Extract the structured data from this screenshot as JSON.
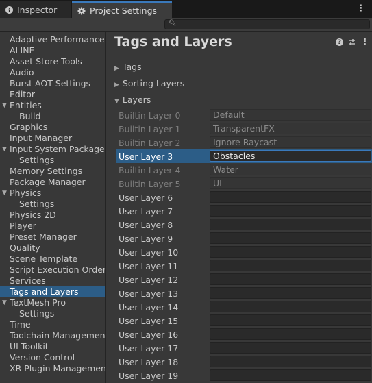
{
  "tabs": {
    "inspector": "Inspector",
    "project_settings": "Project Settings"
  },
  "search": {
    "value": ""
  },
  "sidebar": {
    "selected": "Tags and Layers",
    "items": [
      {
        "label": "Adaptive Performance",
        "level": 0
      },
      {
        "label": "ALINE",
        "level": 0
      },
      {
        "label": "Asset Store Tools",
        "level": 0
      },
      {
        "label": "Audio",
        "level": 0
      },
      {
        "label": "Burst AOT Settings",
        "level": 0
      },
      {
        "label": "Editor",
        "level": 0
      },
      {
        "label": "Entities",
        "level": 0,
        "expanded": true
      },
      {
        "label": "Build",
        "level": 1
      },
      {
        "label": "Graphics",
        "level": 0
      },
      {
        "label": "Input Manager",
        "level": 0
      },
      {
        "label": "Input System Package",
        "level": 0,
        "expanded": true
      },
      {
        "label": "Settings",
        "level": 1
      },
      {
        "label": "Memory Settings",
        "level": 0
      },
      {
        "label": "Package Manager",
        "level": 0
      },
      {
        "label": "Physics",
        "level": 0,
        "expanded": true
      },
      {
        "label": "Settings",
        "level": 1
      },
      {
        "label": "Physics 2D",
        "level": 0
      },
      {
        "label": "Player",
        "level": 0
      },
      {
        "label": "Preset Manager",
        "level": 0
      },
      {
        "label": "Quality",
        "level": 0
      },
      {
        "label": "Scene Template",
        "level": 0
      },
      {
        "label": "Script Execution Order",
        "level": 0
      },
      {
        "label": "Services",
        "level": 0
      },
      {
        "label": "Tags and Layers",
        "level": 0
      },
      {
        "label": "TextMesh Pro",
        "level": 0,
        "expanded": true
      },
      {
        "label": "Settings",
        "level": 1
      },
      {
        "label": "Time",
        "level": 0
      },
      {
        "label": "Toolchain Management",
        "level": 0
      },
      {
        "label": "UI Toolkit",
        "level": 0
      },
      {
        "label": "Version Control",
        "level": 0
      },
      {
        "label": "XR Plugin Management",
        "level": 0
      }
    ]
  },
  "main": {
    "title": "Tags and Layers",
    "sections": {
      "tags": "Tags",
      "sorting_layers": "Sorting Layers",
      "layers": "Layers"
    },
    "layers": [
      {
        "label": "Builtin Layer 0",
        "value": "Default",
        "builtin": true
      },
      {
        "label": "Builtin Layer 1",
        "value": "TransparentFX",
        "builtin": true
      },
      {
        "label": "Builtin Layer 2",
        "value": "Ignore Raycast",
        "builtin": true
      },
      {
        "label": "User Layer 3",
        "value": "Obstacles",
        "builtin": false,
        "selected": true
      },
      {
        "label": "Builtin Layer 4",
        "value": "Water",
        "builtin": true
      },
      {
        "label": "Builtin Layer 5",
        "value": "UI",
        "builtin": true
      },
      {
        "label": "User Layer 6",
        "value": "",
        "builtin": false
      },
      {
        "label": "User Layer 7",
        "value": "",
        "builtin": false
      },
      {
        "label": "User Layer 8",
        "value": "",
        "builtin": false
      },
      {
        "label": "User Layer 9",
        "value": "",
        "builtin": false
      },
      {
        "label": "User Layer 10",
        "value": "",
        "builtin": false
      },
      {
        "label": "User Layer 11",
        "value": "",
        "builtin": false
      },
      {
        "label": "User Layer 12",
        "value": "",
        "builtin": false
      },
      {
        "label": "User Layer 13",
        "value": "",
        "builtin": false
      },
      {
        "label": "User Layer 14",
        "value": "",
        "builtin": false
      },
      {
        "label": "User Layer 15",
        "value": "",
        "builtin": false
      },
      {
        "label": "User Layer 16",
        "value": "",
        "builtin": false
      },
      {
        "label": "User Layer 17",
        "value": "",
        "builtin": false
      },
      {
        "label": "User Layer 18",
        "value": "",
        "builtin": false
      },
      {
        "label": "User Layer 19",
        "value": "",
        "builtin": false
      }
    ]
  }
}
